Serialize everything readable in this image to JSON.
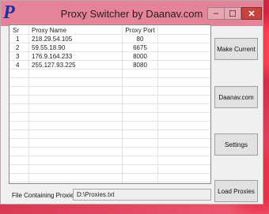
{
  "window": {
    "title": "Proxy Switcher by Daanav.com",
    "icon": "p-logo-icon",
    "controls": {
      "minimize": "–",
      "maximize": "☐",
      "close": "✕"
    }
  },
  "table": {
    "headers": {
      "sr": "Sr",
      "name": "Proxy Name",
      "port": "Proxy Port"
    },
    "rows": [
      {
        "sr": "1",
        "name": "218.29.54.105",
        "port": "80"
      },
      {
        "sr": "2",
        "name": "59.55.18.90",
        "port": "6675"
      },
      {
        "sr": "3",
        "name": "176.9.164.233",
        "port": "8000"
      },
      {
        "sr": "4",
        "name": "255.127.93.225",
        "port": "8080"
      }
    ]
  },
  "buttons": {
    "make_current": "Make Current",
    "daanav": "Daanav.com",
    "settings": "Settings",
    "load_proxies": "Load Proxies"
  },
  "file": {
    "label": "File Containing Proxies :",
    "value": "D:\\Proxies.txt"
  },
  "colors": {
    "titlebar": "#e58498",
    "close": "#c7443e",
    "icon": "#1d2ca8"
  }
}
